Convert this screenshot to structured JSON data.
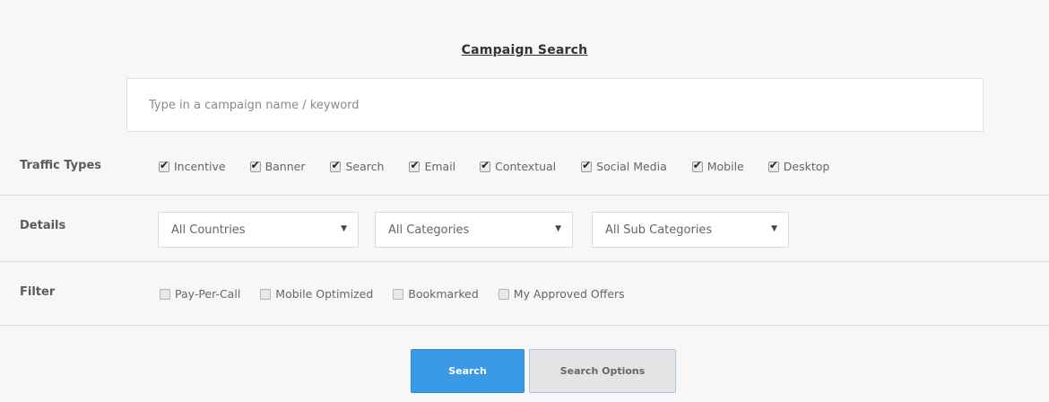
{
  "title": "Campaign Search",
  "search": {
    "placeholder": "Type in a campaign name / keyword",
    "value": ""
  },
  "traffic_types": {
    "label": "Traffic Types",
    "options": [
      {
        "label": "Incentive",
        "checked": true
      },
      {
        "label": "Banner",
        "checked": true
      },
      {
        "label": "Search",
        "checked": true
      },
      {
        "label": "Email",
        "checked": true
      },
      {
        "label": "Contextual",
        "checked": true
      },
      {
        "label": "Social Media",
        "checked": true
      },
      {
        "label": "Mobile",
        "checked": true
      },
      {
        "label": "Desktop",
        "checked": true
      }
    ]
  },
  "details": {
    "label": "Details",
    "selects": [
      {
        "value": "All Countries"
      },
      {
        "value": "All Categories"
      },
      {
        "value": "All Sub Categories"
      }
    ]
  },
  "filter": {
    "label": "Filter",
    "options": [
      {
        "label": "Pay-Per-Call",
        "checked": false
      },
      {
        "label": "Mobile Optimized",
        "checked": false
      },
      {
        "label": "Bookmarked",
        "checked": false
      },
      {
        "label": "My Approved Offers",
        "checked": false
      }
    ]
  },
  "buttons": {
    "search_label": "Search",
    "options_label": "Search Options"
  },
  "colors": {
    "accent": "#3b9ae8",
    "background": "#f7f7f7"
  }
}
